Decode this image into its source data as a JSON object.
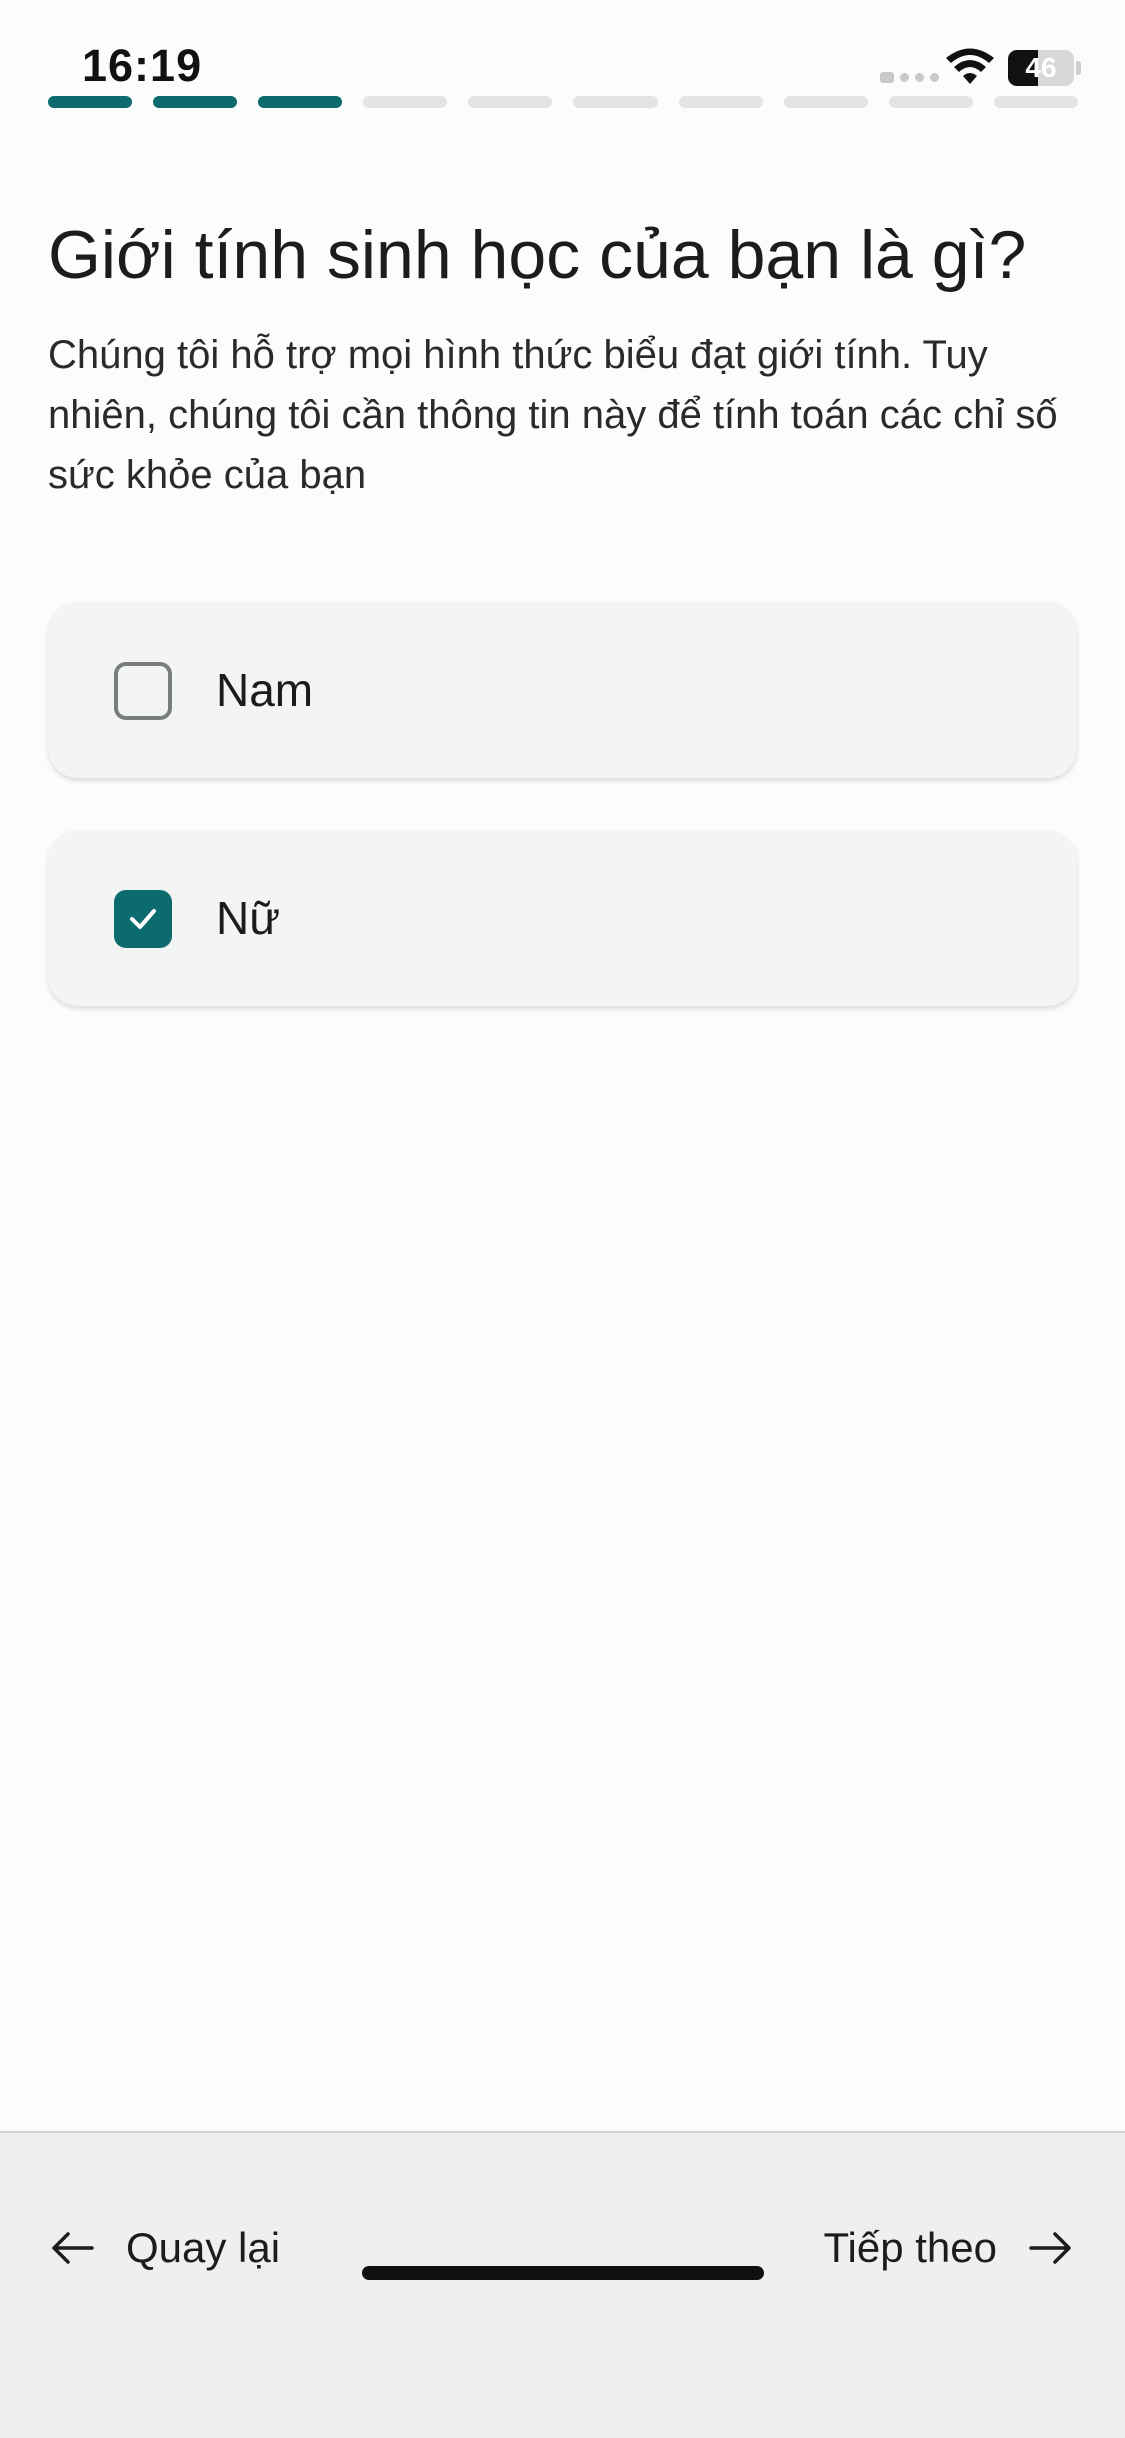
{
  "status_bar": {
    "time": "16:19",
    "battery_level": "46",
    "battery_fraction": 0.46
  },
  "progress": {
    "total_steps": 10,
    "completed_steps": 3,
    "color_done": "#0c6b6e",
    "color_pending": "#e3e5e5"
  },
  "question": {
    "title": "Giới tính sinh học của bạn là gì?",
    "subtitle": "Chúng tôi hỗ trợ mọi hình thức biểu đạt giới tính. Tuy nhiên, chúng tôi cần thông tin này để tính toán các chỉ số sức khỏe của bạn"
  },
  "options": [
    {
      "label": "Nam",
      "checked": false
    },
    {
      "label": "Nữ",
      "checked": true
    }
  ],
  "footer": {
    "back_label": "Quay lại",
    "next_label": "Tiếp theo",
    "back_icon": "arrow-left-icon",
    "next_icon": "arrow-right-icon"
  },
  "colors": {
    "accent": "#0c6b6e"
  }
}
